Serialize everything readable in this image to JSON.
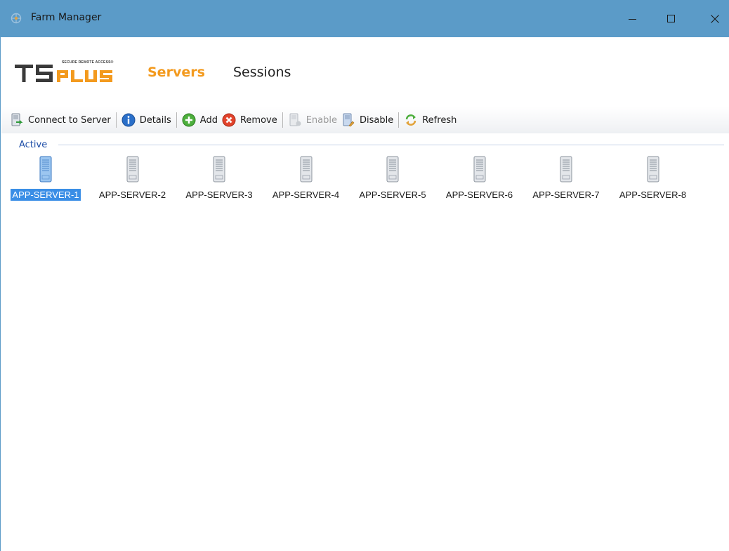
{
  "window": {
    "title": "Farm Manager",
    "controls": {
      "minimize": "minimize-icon",
      "maximize": "maximize-icon",
      "close": "close-icon"
    }
  },
  "header": {
    "logo_text": "TSPLUS",
    "logo_tagline": "SECURE REMOTE ACCESS®",
    "nav": {
      "servers": "Servers",
      "sessions": "Sessions"
    },
    "active_nav": "Servers"
  },
  "toolbar": {
    "connect": "Connect to Server",
    "details": "Details",
    "add": "Add",
    "remove": "Remove",
    "enable": "Enable",
    "disable": "Disable",
    "refresh": "Refresh"
  },
  "group": {
    "label": "Active"
  },
  "servers": [
    {
      "name": "APP-SERVER-1",
      "selected": true
    },
    {
      "name": "APP-SERVER-2",
      "selected": false
    },
    {
      "name": "APP-SERVER-3",
      "selected": false
    },
    {
      "name": "APP-SERVER-4",
      "selected": false
    },
    {
      "name": "APP-SERVER-5",
      "selected": false
    },
    {
      "name": "APP-SERVER-6",
      "selected": false
    },
    {
      "name": "APP-SERVER-7",
      "selected": false
    },
    {
      "name": "APP-SERVER-8",
      "selected": false
    }
  ],
  "colors": {
    "titlebar": "#5b9bc8",
    "accent_orange": "#f39a1e",
    "selection": "#3a8ee6",
    "group_label": "#1f4fa8"
  }
}
